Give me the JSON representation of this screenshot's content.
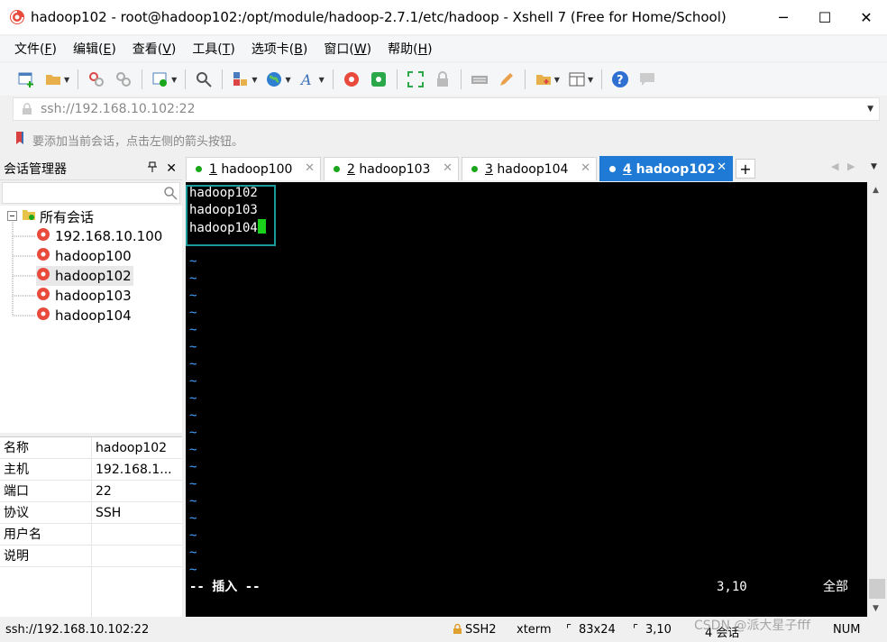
{
  "window": {
    "title": "hadoop102 - root@hadoop102:/opt/module/hadoop-2.7.1/etc/hadoop - Xshell 7 (Free for Home/School)",
    "minimize": "─",
    "maximize": "☐",
    "close": "✕"
  },
  "menu": [
    {
      "label": "文件(",
      "key": "F",
      "tail": ")"
    },
    {
      "label": "编辑(",
      "key": "E",
      "tail": ")"
    },
    {
      "label": "查看(",
      "key": "V",
      "tail": ")"
    },
    {
      "label": "工具(",
      "key": "T",
      "tail": ")"
    },
    {
      "label": "选项卡(",
      "key": "B",
      "tail": ")"
    },
    {
      "label": "窗口(",
      "key": "W",
      "tail": ")"
    },
    {
      "label": "帮助(",
      "key": "H",
      "tail": ")"
    }
  ],
  "address": {
    "value": "ssh://192.168.10.102:22"
  },
  "hint": {
    "text": "要添加当前会话，点击左侧的箭头按钮。"
  },
  "session_manager": {
    "title": "会话管理器",
    "pin": "ᵩ",
    "close": "✕",
    "root": "所有会话",
    "items": [
      "192.168.10.100",
      "hadoop100",
      "hadoop102",
      "hadoop103",
      "hadoop104"
    ]
  },
  "properties": [
    {
      "key": "名称",
      "value": "hadoop102"
    },
    {
      "key": "主机",
      "value": "192.168.1..."
    },
    {
      "key": "端口",
      "value": "22"
    },
    {
      "key": "协议",
      "value": "SSH"
    },
    {
      "key": "用户名",
      "value": ""
    },
    {
      "key": "说明",
      "value": ""
    }
  ],
  "tabs": [
    {
      "num": "1",
      "label": " hadoop100"
    },
    {
      "num": "2",
      "label": " hadoop103"
    },
    {
      "num": "3",
      "label": " hadoop104"
    },
    {
      "num": "4",
      "label": " hadoop102"
    }
  ],
  "tab_add": "+",
  "terminal": {
    "lines": [
      "hadoop102",
      "hadoop103",
      "hadoop104"
    ],
    "tilde": "~",
    "mode": "-- 插入 --",
    "position": "3,10",
    "scope": "全部"
  },
  "status": {
    "address": "ssh://192.168.10.102:22",
    "protocol": "SSH2",
    "term": "xterm",
    "size": "83x24",
    "cursor": "3,10",
    "sessions": "4 会话",
    "num": "NUM"
  },
  "watermark": "CSDN @派大星子fff",
  "colors": {
    "active_tab": "#1f7ad6",
    "terminal_bg": "#000000",
    "tilde": "#40a0ff",
    "cursor": "#1ad01a",
    "highlight_box": "#1a9a9a"
  }
}
